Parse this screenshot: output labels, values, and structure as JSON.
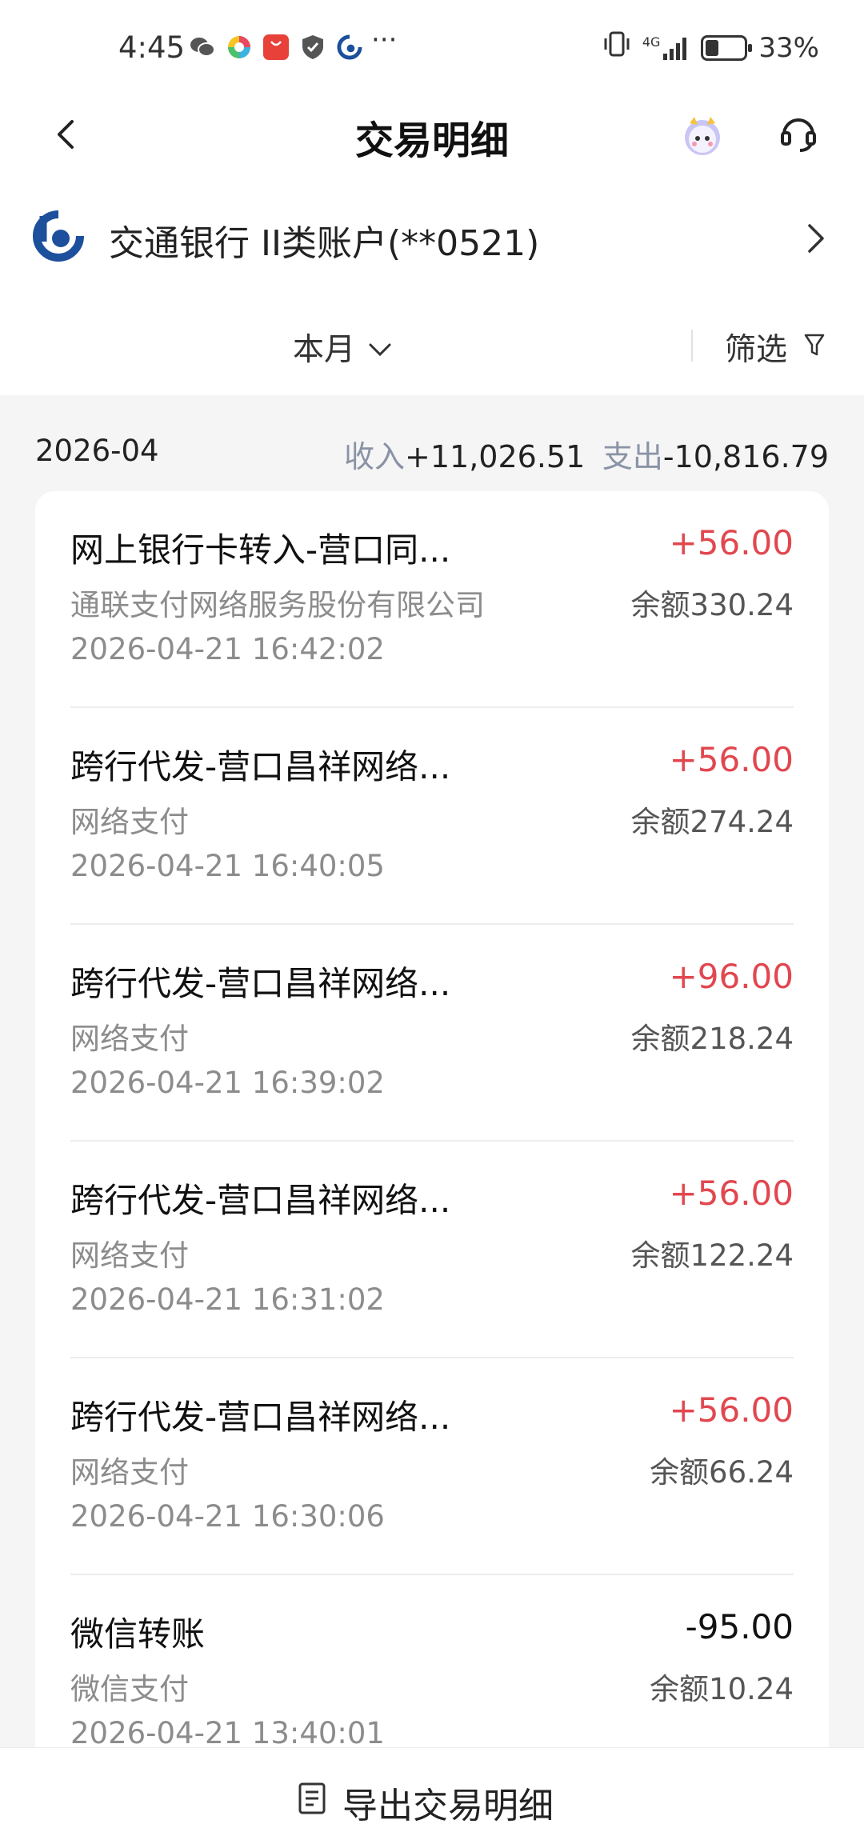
{
  "status_bar": {
    "time": "4:45",
    "network": "4G",
    "battery_percent": "33%",
    "battery_level": 0.33
  },
  "header": {
    "title": "交易明细"
  },
  "account": {
    "name": "交通银行 II类账户(**0521)"
  },
  "filter": {
    "period": "本月",
    "filter_label": "筛选"
  },
  "summary": {
    "month": "2026-04",
    "income_label": "收入",
    "income_value": "+11,026.51",
    "expense_label": "支出",
    "expense_value": "-10,816.79"
  },
  "transactions": [
    {
      "title": "网上银行卡转入-营口同...",
      "sub": "通联支付网络服务股份有限公司",
      "time": "2026-04-21 16:42:02",
      "amount": "+56.00",
      "balance": "余额330.24",
      "type": "income"
    },
    {
      "title": "跨行代发-营口昌祥网络...",
      "sub": "网络支付",
      "time": "2026-04-21 16:40:05",
      "amount": "+56.00",
      "balance": "余额274.24",
      "type": "income"
    },
    {
      "title": "跨行代发-营口昌祥网络...",
      "sub": "网络支付",
      "time": "2026-04-21 16:39:02",
      "amount": "+96.00",
      "balance": "余额218.24",
      "type": "income"
    },
    {
      "title": "跨行代发-营口昌祥网络...",
      "sub": "网络支付",
      "time": "2026-04-21 16:31:02",
      "amount": "+56.00",
      "balance": "余额122.24",
      "type": "income"
    },
    {
      "title": "跨行代发-营口昌祥网络...",
      "sub": "网络支付",
      "time": "2026-04-21 16:30:06",
      "amount": "+56.00",
      "balance": "余额66.24",
      "type": "income"
    },
    {
      "title": "微信转账",
      "sub": "微信支付",
      "time": "2026-04-21 13:40:01",
      "amount": "-95.00",
      "balance": "余额10.24",
      "type": "expense"
    }
  ],
  "bottom": {
    "export_label": "导出交易明细"
  },
  "colors": {
    "income": "#e1474f",
    "label_blue_gray": "#8a93a6",
    "bank_blue": "#1c4f9c"
  }
}
